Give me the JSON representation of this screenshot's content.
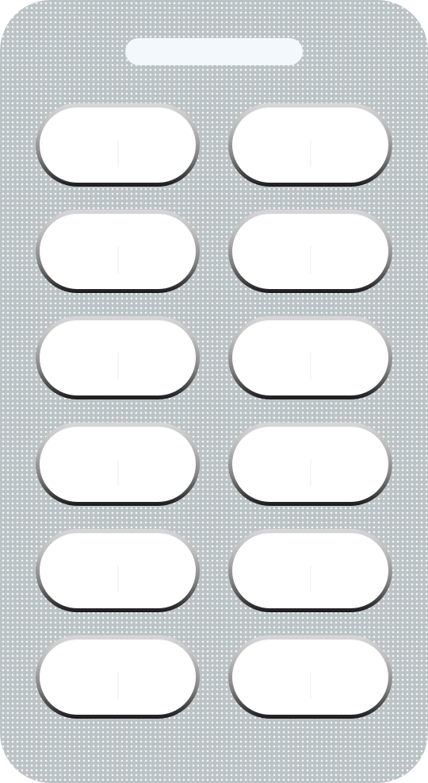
{
  "blister_pack": {
    "rows": 6,
    "columns": 2,
    "foil_color": "#bcc3c6",
    "pill_color": "#ffffff",
    "slot_color": "#f3f8fc",
    "pill_shape": "capsule-tablet",
    "pills": [
      {
        "row": 1,
        "col": 1
      },
      {
        "row": 1,
        "col": 2
      },
      {
        "row": 2,
        "col": 1
      },
      {
        "row": 2,
        "col": 2
      },
      {
        "row": 3,
        "col": 1
      },
      {
        "row": 3,
        "col": 2
      },
      {
        "row": 4,
        "col": 1
      },
      {
        "row": 4,
        "col": 2
      },
      {
        "row": 5,
        "col": 1
      },
      {
        "row": 5,
        "col": 2
      },
      {
        "row": 6,
        "col": 1
      },
      {
        "row": 6,
        "col": 2
      }
    ]
  }
}
